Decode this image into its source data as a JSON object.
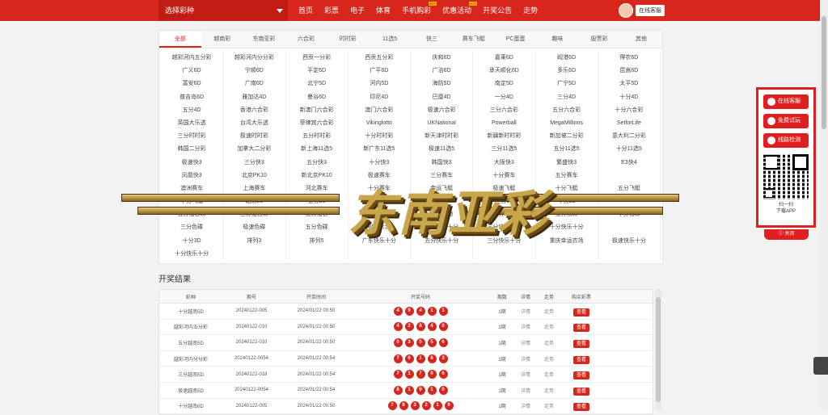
{
  "header": {
    "selector_label": "选择彩种",
    "nav": [
      {
        "label": "首页",
        "hot": ""
      },
      {
        "label": "彩票",
        "hot": ""
      },
      {
        "label": "电子",
        "hot": ""
      },
      {
        "label": "体育",
        "hot": ""
      },
      {
        "label": "手机购彩",
        "hot": "HOT"
      },
      {
        "label": "优惠活动",
        "hot": "HOT"
      },
      {
        "label": "开奖公告",
        "hot": ""
      },
      {
        "label": "走势",
        "hot": ""
      }
    ],
    "user_label": "在线客服"
  },
  "tabs": [
    "全部",
    "越南彩",
    "东南亚彩",
    "六合彩",
    "时时彩",
    "11选5",
    "快三",
    "赛车飞艇",
    "PC蛋蛋",
    "趣味",
    "股票彩",
    "其他"
  ],
  "lotteries": [
    "越彩河内五分彩",
    "越彩河内分分彩",
    "西贡一分彩",
    "西贡五分彩",
    "庆和6D",
    "嘉莱6D",
    "岘港6D",
    "得农6D",
    "广义6D",
    "宁顺6D",
    "平定6D",
    "广平6D",
    "广治6D",
    "承天顺化6D",
    "多乐6D",
    "昆嵩6D",
    "富安6D",
    "广南6D",
    "北宁5D",
    "河内5D",
    "海防5D",
    "南定5D",
    "广宁5D",
    "太平5D",
    "普吉岛6D",
    "雅加达4D",
    "曼谷6D",
    "印尼4D",
    "巴厘4D",
    "一分4D",
    "三分4D",
    "十分4D",
    "五分4D",
    "香港六合彩",
    "新澳门六合彩",
    "澳门六合彩",
    "极速六合彩",
    "三分六合彩",
    "五分六合彩",
    "十分六合彩",
    "英国大乐透",
    "台湾大乐透",
    "菲律宾六合彩",
    "Vikinglotto",
    "UKNational",
    "Powerball",
    "MegaMillions",
    "SetforLife",
    "三分时时彩",
    "极速时时彩",
    "五分时时彩",
    "十分时时彩",
    "新天津时时彩",
    "新疆新时时彩",
    "新加坡二分彩",
    "意大利二分彩",
    "韩国二分彩",
    "加拿大二分彩",
    "新上海11选5",
    "新广东11选5",
    "极速11选5",
    "三分11选5",
    "五分11选5",
    "十分11选5",
    "极速快3",
    "三分快3",
    "五分快3",
    "十分快3",
    "韩国快3",
    "大阪快3",
    "繁盛快3",
    "E3快4",
    "凤凰快3",
    "北京PK10",
    "新北京PK10",
    "极速赛车",
    "三分赛车",
    "十分赛车",
    "五分赛车",
    "",
    "澳洲赛车",
    "上海赛车",
    "河北赛车",
    "十分赛车",
    "幸运飞艇",
    "极速飞艇",
    "十分飞艇",
    "五分飞艇",
    "十分飞艇",
    "北京28",
    "五分28",
    "加拿大28",
    "极速28",
    "三分28",
    "十分28",
    "",
    "五分组合彩",
    "三分组合彩",
    "五分组合",
    "十分组合",
    "五分动物",
    "十分动物",
    "五分物彩",
    "十分物彩",
    "三分色碟",
    "极速色碟",
    "五分色碟",
    "极速六合",
    "五分快乐十分",
    "三分快乐十分",
    "十分快乐十分",
    "",
    "十分3D",
    "排列3",
    "排列5",
    "广东快乐十分",
    "五分快乐十分",
    "三分快乐十分",
    "重庆幸运农场",
    "极速快乐十分",
    "十分快乐十分",
    "",
    "",
    "",
    "",
    "",
    "",
    ""
  ],
  "results": {
    "title": "开奖结果",
    "columns": [
      "彩种",
      "期号",
      "开奖时间",
      "开奖号码",
      "期数",
      "详情",
      "走势",
      "购买彩票"
    ],
    "rows": [
      {
        "name": "十分越南5D",
        "issue": "20240122-005",
        "time": "2024/01/22 00:50",
        "balls": [
          "4",
          "9",
          "4",
          "1",
          "1"
        ],
        "count": "1期",
        "detail": "详情",
        "trend": "走势",
        "buy": "查看"
      },
      {
        "name": "越彩河内五分彩",
        "issue": "20240122-010",
        "time": "2024/01/22 00:50",
        "balls": [
          "4",
          "2",
          "8",
          "4",
          "0"
        ],
        "count": "1期",
        "detail": "详情",
        "trend": "走势",
        "buy": "查看"
      },
      {
        "name": "五分越南5D",
        "issue": "20240122-010",
        "time": "2024/01/22 00:50",
        "balls": [
          "0",
          "3",
          "5",
          "5",
          "6"
        ],
        "count": "1期",
        "detail": "详情",
        "trend": "走势",
        "buy": "查看"
      },
      {
        "name": "越彩河内分分彩",
        "issue": "20240122-0054",
        "time": "2024/01/22 00:54",
        "balls": [
          "7",
          "6",
          "1",
          "6",
          "3"
        ],
        "count": "1期",
        "detail": "详情",
        "trend": "走势",
        "buy": "查看"
      },
      {
        "name": "三分越南5D",
        "issue": "20240122-018",
        "time": "2024/01/22 00:54",
        "balls": [
          "7",
          "1",
          "7",
          "0",
          "6"
        ],
        "count": "1期",
        "detail": "详情",
        "trend": "走势",
        "buy": "查看"
      },
      {
        "name": "极速越南5D",
        "issue": "20240122-0054",
        "time": "2024/01/22 00:54",
        "balls": [
          "8",
          "1",
          "9",
          "1",
          "0"
        ],
        "count": "1期",
        "detail": "详情",
        "trend": "走势",
        "buy": "查看"
      },
      {
        "name": "十分越南6D",
        "issue": "20240122-005",
        "time": "2024/01/22 00:50",
        "balls": [
          "7",
          "8",
          "3",
          "2",
          "1",
          "9"
        ],
        "count": "1期",
        "detail": "详情",
        "trend": "走势",
        "buy": "查看"
      }
    ]
  },
  "side": {
    "buttons": [
      "在线客服",
      "免费试玩",
      "线路检测"
    ],
    "scan_line1": "扫一扫",
    "scan_line2": "下载APP",
    "close_label": "关闭"
  },
  "banner": {
    "text": "东南亚彩"
  },
  "colors": {
    "brand": "#d9261c",
    "gold": "#c8a64c"
  }
}
